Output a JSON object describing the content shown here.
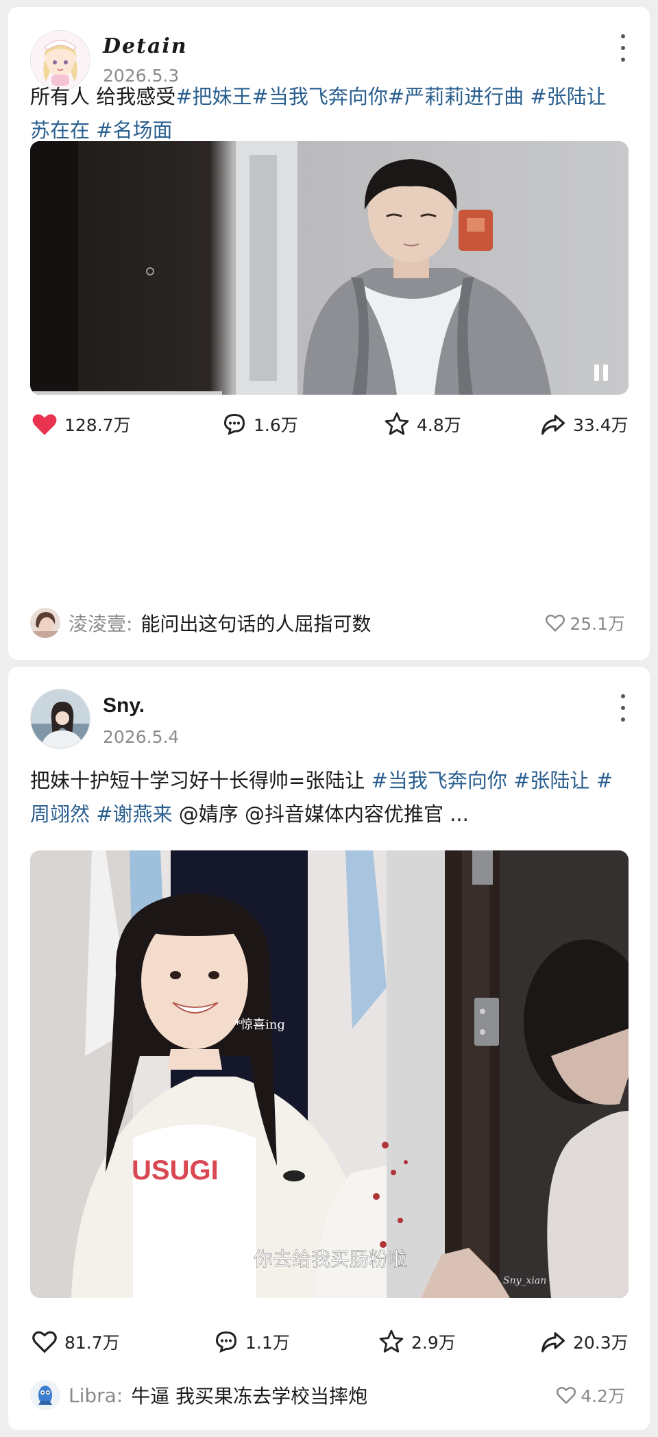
{
  "posts": [
    {
      "author": "Detain",
      "date": "2026.5.3",
      "caption": [
        {
          "text": "所有人 给我感受",
          "type": "text"
        },
        {
          "text": "#把妹王",
          "type": "tag"
        },
        {
          "text": "#当我飞奔向你",
          "type": "tag"
        },
        {
          "text": "#严莉莉进行曲",
          "type": "tag"
        },
        {
          "text": " ",
          "type": "text"
        },
        {
          "text": "#张陆让苏在在",
          "type": "tag"
        },
        {
          "text": " ",
          "type": "text"
        },
        {
          "text": "#名场面",
          "type": "tag"
        }
      ],
      "media": {
        "kind": "video",
        "state": "playing",
        "control_icon": "pause-icon"
      },
      "likes": "128.7万",
      "liked": true,
      "comments": "1.6万",
      "favorites": "4.8万",
      "shares": "33.4万",
      "top_comment": {
        "user": "淩淩壹",
        "separator": ":",
        "text": "能问出这句话的人屈指可数",
        "likes": "25.1万"
      }
    },
    {
      "author": "Sny.",
      "date": "2026.5.4",
      "caption": [
        {
          "text": "把妹十护短十学习好十长得帅=张陆让",
          "type": "text"
        },
        {
          "text": " ",
          "type": "text"
        },
        {
          "text": "#当我飞奔向你",
          "type": "tag"
        },
        {
          "text": " ",
          "type": "text"
        },
        {
          "text": "#张陆让",
          "type": "tag"
        },
        {
          "text": " ",
          "type": "text"
        },
        {
          "text": "#周翊然",
          "type": "tag"
        },
        {
          "text": " ",
          "type": "text"
        },
        {
          "text": "#谢燕来",
          "type": "tag"
        },
        {
          "text": "  @婧序 @抖音媒体内容优推官 ...",
          "type": "text"
        }
      ],
      "media": {
        "kind": "image",
        "shirt_text": "USUGI",
        "overlay_text": "*惊喜ing",
        "subtitle": "你去给我买肠粉啦",
        "watermark": "Sny_xian"
      },
      "likes": "81.7万",
      "liked": false,
      "comments": "1.1万",
      "favorites": "2.9万",
      "shares": "20.3万",
      "top_comment": {
        "user": "Libra",
        "separator": ":",
        "text": "牛逼 我买果冻去学校当摔炮",
        "likes": "4.2万"
      }
    }
  ],
  "colors": {
    "like_active": "#e8344e",
    "tag": "#2a5f8f",
    "meta": "#8a8a8a"
  },
  "icons": {
    "like": "heart-icon",
    "comment": "comment-bubble-icon",
    "favorite": "star-icon",
    "share": "share-arrow-icon",
    "more": "more-vertical-icon"
  }
}
